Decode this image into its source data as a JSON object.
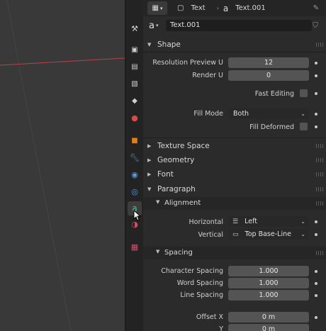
{
  "header": {
    "editor_type_icon": "properties-editor-icon",
    "object_icon": "object-data-icon",
    "object_name": "Text",
    "data_icon": "text-data-icon",
    "data_name": "Text.001",
    "pin_icon": "pin-icon"
  },
  "datablock": {
    "icon": "text-data-icon",
    "name": "Text.001",
    "fake_user_icon": "shield-icon"
  },
  "tabs": [
    {
      "name": "tool",
      "icon": "tool-icon"
    },
    {
      "name": "render",
      "icon": "render-icon"
    },
    {
      "name": "output",
      "icon": "output-icon"
    },
    {
      "name": "view-layer",
      "icon": "view-layer-icon"
    },
    {
      "name": "scene",
      "icon": "scene-icon"
    },
    {
      "name": "world",
      "icon": "world-icon"
    },
    {
      "name": "object",
      "icon": "object-icon"
    },
    {
      "name": "modifiers",
      "icon": "wrench-icon"
    },
    {
      "name": "particles",
      "icon": "particles-icon"
    },
    {
      "name": "physics",
      "icon": "physics-icon"
    },
    {
      "name": "object-data",
      "icon": "text-data-icon",
      "active": true
    },
    {
      "name": "material",
      "icon": "material-icon"
    },
    {
      "name": "texture",
      "icon": "texture-icon"
    }
  ],
  "shape": {
    "title": "Shape",
    "resolution_preview_label": "Resolution Preview U",
    "resolution_preview_value": "12",
    "render_u_label": "Render U",
    "render_u_value": "0",
    "fast_editing_label": "Fast Editing",
    "fill_mode_label": "Fill Mode",
    "fill_mode_value": "Both",
    "fill_deformed_label": "Fill Deformed"
  },
  "collapsed_sections": {
    "texture_space": "Texture Space",
    "geometry": "Geometry",
    "font": "Font"
  },
  "paragraph": {
    "title": "Paragraph",
    "alignment": {
      "title": "Alignment",
      "horizontal_label": "Horizontal",
      "horizontal_value": "Left",
      "vertical_label": "Vertical",
      "vertical_value": "Top Base-Line"
    },
    "spacing": {
      "title": "Spacing",
      "character_label": "Character Spacing",
      "character_value": "1.000",
      "word_label": "Word Spacing",
      "word_value": "1.000",
      "line_label": "Line Spacing",
      "line_value": "1.000",
      "offset_x_label": "Offset X",
      "offset_x_value": "0 m",
      "offset_y_label": "Y",
      "offset_y_value": "0 m"
    }
  },
  "colors": {
    "object_orange": "#e87d0d",
    "text_data_green": "#4fc19a",
    "x_axis_red": "#b9404c"
  }
}
